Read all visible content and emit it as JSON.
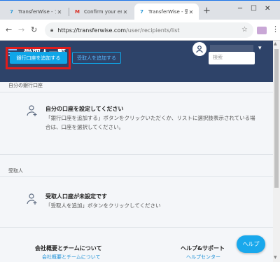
{
  "browser": {
    "tabs": [
      {
        "title": "TransferWise - プロフ",
        "favicon": "transferwise-icon"
      },
      {
        "title": "Confirm your email a",
        "favicon": "gmail-icon"
      },
      {
        "title": "TransferWise - 受取人",
        "favicon": "transferwise-icon"
      }
    ],
    "new_tab": "+",
    "url_host": "https://transferwise.com",
    "url_path": "/user/recipients/list"
  },
  "app": {
    "page_title": "受取人一覧",
    "add_bank_button": "銀行口座を追加する",
    "add_recipient_button": "受取人を追加する",
    "search_placeholder": "検索",
    "accent_color": "#0fa6e8",
    "header_color": "#2e4369"
  },
  "sections": {
    "my_accounts": {
      "label": "自分の銀行口座",
      "empty_title": "自分の口座を設定してください",
      "empty_desc": "「銀行口座を追加する」ボタンをクリックいただくか、リストに選択肢表示されている場合は、口座を選択してください。"
    },
    "recipients": {
      "label": "受取人",
      "empty_title": "受取人口座が未設定です",
      "empty_desc": "「受取人を追加」ボタンをクリックしてください"
    }
  },
  "footer": {
    "col1_title": "会社概要とチームについて",
    "col1_link": "会社概要とチームについて",
    "col2_title": "ヘルプ&サポート",
    "col2_link": "ヘルプセンター"
  },
  "help_button": "ヘルプ"
}
